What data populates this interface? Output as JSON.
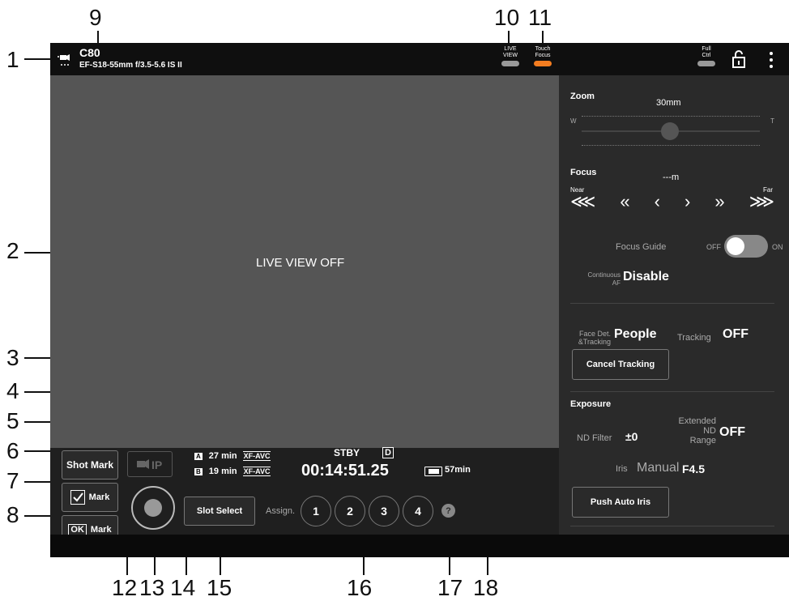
{
  "callouts": {
    "c1": "1",
    "c2": "2",
    "c3": "3",
    "c4": "4",
    "c5": "5",
    "c6": "6",
    "c7": "7",
    "c8": "8",
    "c9": "9",
    "c10": "10",
    "c11": "11",
    "c12": "12",
    "c13": "13",
    "c14": "14",
    "c15": "15",
    "c16": "16",
    "c17": "17",
    "c18": "18"
  },
  "topbar": {
    "model": "C80",
    "lens": "EF-S18-55mm f/3.5-5.6 IS II",
    "live_view_label": "LIVE\nVIEW",
    "touch_focus_label": "Touch\nFocus",
    "full_ctrl_label": "Full\nCtrl"
  },
  "live": {
    "status": "LIVE VIEW OFF"
  },
  "bottom": {
    "shot_mark": "Shot Mark",
    "check_mark_label": "Mark",
    "ok_mark_label": "Mark",
    "ok_icon_text": "OK",
    "slot_a_letter": "A",
    "slot_a_time": "27 min",
    "slot_a_format": "XF-AVC",
    "slot_b_letter": "B",
    "slot_b_time": "19 min",
    "slot_b_format": "XF-AVC",
    "status": "STBY",
    "timecode": "00:14:51.25",
    "d_icon_text": "D",
    "battery": "57min",
    "slot_select": "Slot Select",
    "assign_label": "Assign.",
    "assign_buttons": [
      "1",
      "2",
      "3",
      "4"
    ],
    "help": "?"
  },
  "right": {
    "zoom_label": "Zoom",
    "zoom_value": "30mm",
    "zoom_w": "W",
    "zoom_t": "T",
    "focus_label": "Focus",
    "focus_value": "---m",
    "focus_near": "Near",
    "focus_far": "Far",
    "focus_buttons": [
      "⋘",
      "«",
      "‹",
      "›",
      "»",
      "⋙"
    ],
    "focus_guide_label": "Focus Guide",
    "focus_guide_off": "OFF",
    "focus_guide_on": "ON",
    "continuous_af_label_1": "Continuous",
    "continuous_af_label_2": "AF",
    "continuous_af_value": "Disable",
    "face_det_label_1": "Face Det.",
    "face_det_label_2": "&Tracking",
    "face_det_value": "People",
    "tracking_label": "Tracking",
    "tracking_value": "OFF",
    "cancel_tracking": "Cancel Tracking",
    "exposure_label": "Exposure",
    "nd_filter_label": "ND Filter",
    "nd_filter_value": "±0",
    "extended_nd_1": "Extended",
    "extended_nd_2": "ND",
    "extended_nd_3": "Range",
    "extended_nd_value": "OFF",
    "iris_label": "Iris",
    "iris_mode": "Manual",
    "iris_value": "F4.5",
    "push_auto_iris": "Push Auto Iris"
  },
  "colors": {
    "accent_orange": "#f47d20",
    "toggle_gray": "#999999"
  }
}
